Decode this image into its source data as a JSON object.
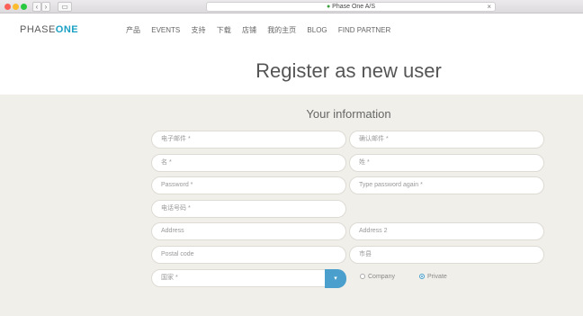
{
  "browser": {
    "back": "‹",
    "forward": "›",
    "sidebar": "▭",
    "url": "Phase One A/S",
    "close": "×"
  },
  "header": {
    "logo_a": "PHASE",
    "logo_b": "ONE",
    "nav": [
      "产品",
      "EVENTS",
      "支持",
      "下载",
      "店铺",
      "我的主页",
      "BLOG",
      "FIND PARTNER"
    ],
    "title": "Register as new user"
  },
  "form": {
    "section": "Your information",
    "email": "电子邮件 *",
    "confirm_email": "确认邮件 *",
    "first_name": "名 *",
    "last_name": "姓 *",
    "password": "Password *",
    "password_again": "Type password again *",
    "phone": "电话号码 *",
    "address": "Address",
    "address2": "Address 2",
    "postal": "Postal code",
    "city": "市县",
    "country": "国家 *",
    "dropdown": "▾",
    "company": "Company",
    "private": "Private",
    "selected_type": "Private"
  }
}
